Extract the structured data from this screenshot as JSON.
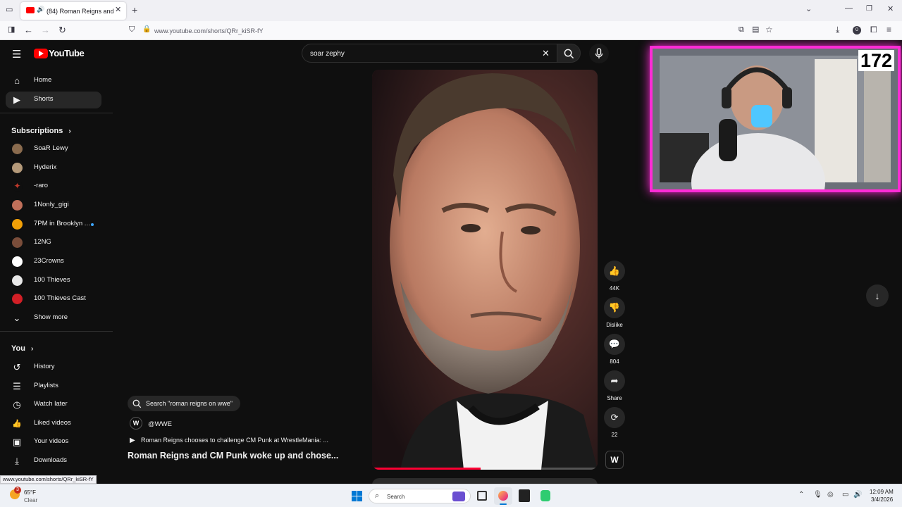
{
  "browser": {
    "tab_title": "(84) Roman Reigns and CM",
    "url": "www.youtube.com/shorts/QRr_kiSR-fY",
    "new_tab": "+",
    "profile_badge": "0"
  },
  "youtube": {
    "logo_text": "YouTube",
    "search": {
      "value": "soar zephy"
    }
  },
  "sidebar": {
    "main": [
      {
        "label": "Home",
        "icon": "home-icon",
        "glyph": "⌂"
      },
      {
        "label": "Shorts",
        "icon": "shorts-icon",
        "glyph": "▶"
      }
    ],
    "subscriptions_title": "Subscriptions",
    "subscriptions": [
      {
        "label": "SoaR Lewy",
        "color": "#8a6b4e"
      },
      {
        "label": "Hyderix",
        "color": "#b59a7a"
      },
      {
        "label": "-raro",
        "color": "#c0392b"
      },
      {
        "label": "1Nonly_gigi",
        "color": "#c0705a"
      },
      {
        "label": "7PM in Brooklyn ...",
        "color": "#f2a007"
      },
      {
        "label": "12NG",
        "color": "#7a4d3a"
      },
      {
        "label": "23Crowns",
        "color": "#ffffff"
      },
      {
        "label": "100 Thieves",
        "color": "#e8e8e8"
      },
      {
        "label": "100 Thieves Cast",
        "color": "#d21f26"
      }
    ],
    "show_more": "Show more",
    "you_title": "You",
    "you": [
      {
        "label": "History",
        "icon": "history-icon",
        "glyph": "↺"
      },
      {
        "label": "Playlists",
        "icon": "playlists-icon",
        "glyph": "☰"
      },
      {
        "label": "Watch later",
        "icon": "watch-later-icon",
        "glyph": "◷"
      },
      {
        "label": "Liked videos",
        "icon": "like-icon",
        "glyph": "👍"
      },
      {
        "label": "Your videos",
        "icon": "your-videos-icon",
        "glyph": "▣"
      },
      {
        "label": "Downloads",
        "icon": "download-icon",
        "glyph": "⤓"
      }
    ]
  },
  "short": {
    "related_search": "Search \"roman reigns on wwe\"",
    "channel": "@WWE",
    "channel_logo": "W",
    "related_video": "Roman Reigns chooses to challenge CM Punk at WrestleMania: ...",
    "title": "Roman Reigns and CM Punk woke up and chose...",
    "progress": 0.48
  },
  "actions": {
    "likes": "44K",
    "dislike": "Dislike",
    "comments": "804",
    "share": "Share",
    "remix": "22"
  },
  "overlay": {
    "counter": "172"
  },
  "status_url": "www.youtube.com/shorts/QRr_kiSR-fY",
  "taskbar": {
    "weather_temp": "65°F",
    "weather_desc": "Clear",
    "weather_badge": "3",
    "search_placeholder": "Search",
    "time": "12:09 AM",
    "date": "3/4/2026"
  },
  "colors": {
    "youtube_red": "#ff0000",
    "overlay_magenta": "#ff2bd6",
    "page_bg": "#0f0f0f"
  }
}
